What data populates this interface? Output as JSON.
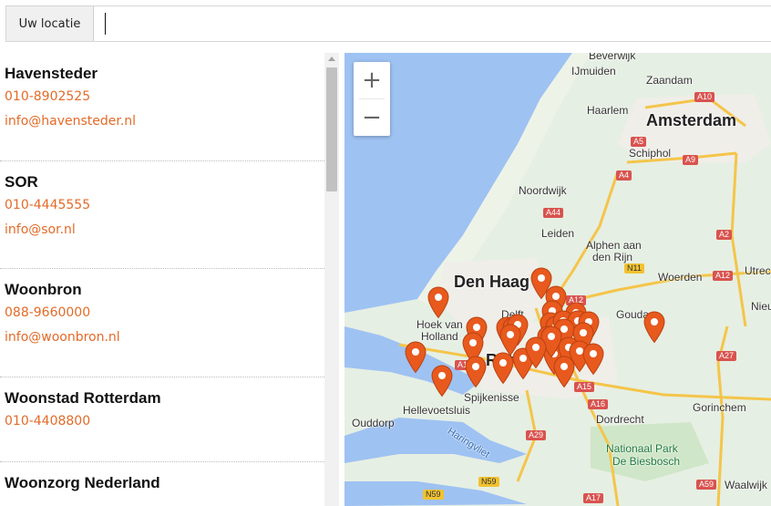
{
  "search": {
    "button_label": "Uw locatie",
    "value": ""
  },
  "list": [
    {
      "name": "Havensteder",
      "phone": "010-8902525",
      "email": "info@havensteder.nl"
    },
    {
      "name": "SOR",
      "phone": "010-4445555",
      "email": "info@sor.nl"
    },
    {
      "name": "Woonbron",
      "phone": "088-9660000",
      "email": "info@woonbron.nl"
    },
    {
      "name": "Woonstad Rotterdam",
      "phone": "010-4408800",
      "email": ""
    },
    {
      "name": "Woonzorg Nederland",
      "phone": "",
      "email": ""
    }
  ],
  "map": {
    "zoom_in": "+",
    "zoom_out": "−",
    "cities": {
      "amsterdam": "Amsterdam",
      "den_haag": "Den Haag",
      "rotterdam": "Rott"
    },
    "towns": {
      "beverwijk": "Beverwijk",
      "ijmuiden": "IJmuiden",
      "zaandam": "Zaandam",
      "haarlem": "Haarlem",
      "schiphol": "Schiphol",
      "noordwijk": "Noordwijk",
      "leiden": "Leiden",
      "alphen_1": "Alphen aan",
      "alphen_2": "den Rijn",
      "woerden": "Woerden",
      "utrecht": "Utrec",
      "nieuwegein": "Nieuweg",
      "delft": "Delft",
      "gouda": "Gouda",
      "hoek_1": "Hoek van",
      "hoek_2": "Holland",
      "spijkenisse": "Spijkenisse",
      "hellevoetsluis": "Hellevoetsluis",
      "ouddorp": "Ouddorp",
      "dordrecht": "Dordrecht",
      "gorinchem": "Gorinchem",
      "waalwijk": "Waalwijk"
    },
    "park": {
      "line1": "Nationaal Park",
      "line2": "De Biesbosch"
    },
    "water": {
      "haringvliet": "Haringvliet"
    },
    "roads": {
      "a10": "A10",
      "a5": "A5",
      "a4": "A4",
      "a9": "A9",
      "a44": "A44",
      "n11": "N11",
      "a2": "A2",
      "a12_a": "A12",
      "a12_b": "A12",
      "a27": "A27",
      "a15_a": "A15",
      "a15_b": "A15",
      "a16": "A16",
      "a29": "A29",
      "n59_a": "N59",
      "n59_b": "N59",
      "a17": "A17",
      "a59": "A59"
    },
    "marker_color": "#e8591e",
    "land_color": "#e6efe3",
    "water_color": "#9ec2f2"
  }
}
